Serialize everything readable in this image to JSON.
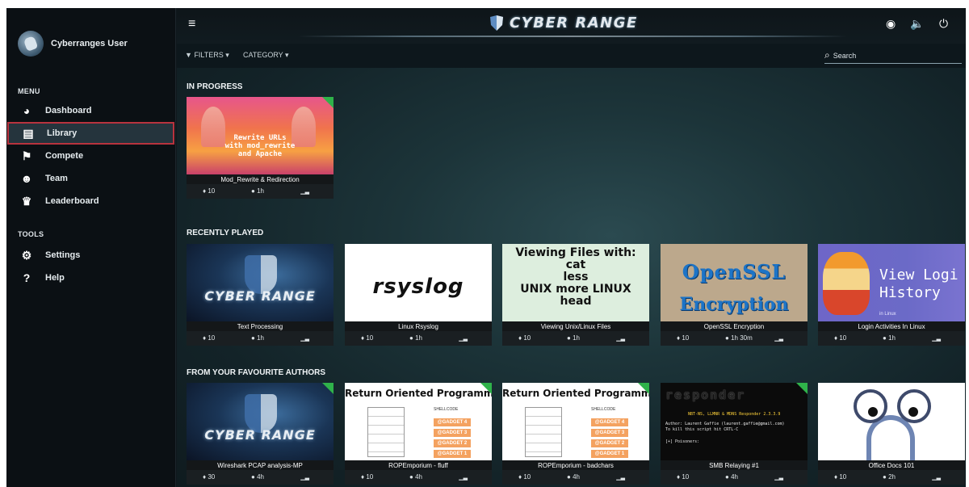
{
  "user": {
    "name": "Cyberranges User"
  },
  "sidebar": {
    "menu_label": "MENU",
    "tools_label": "TOOLS",
    "menu_items": [
      {
        "label": "Dashboard",
        "icon": "speedometer-icon"
      },
      {
        "label": "Library",
        "icon": "book-icon",
        "active": true
      },
      {
        "label": "Compete",
        "icon": "checkered-flag-icon"
      },
      {
        "label": "Team",
        "icon": "users-icon"
      },
      {
        "label": "Leaderboard",
        "icon": "trophy-icon"
      }
    ],
    "tool_items": [
      {
        "label": "Settings",
        "icon": "gear-icon"
      },
      {
        "label": "Help",
        "icon": "question-icon"
      }
    ]
  },
  "topbar": {
    "brand": "CYBER RANGE"
  },
  "filters": {
    "filters_label": "FILTERS",
    "category_label": "CATEGORY",
    "search_placeholder": "Search"
  },
  "sections": {
    "in_progress": "IN PROGRESS",
    "recently_played": "RECENTLY PLAYED",
    "favourite_authors": "FROM YOUR FAVOURITE AUTHORS"
  },
  "cards": {
    "mod": {
      "thumb_text": "Rewrite URLs\nwith mod_rewrite\nand Apache",
      "title": "Mod_Rewrite & Redirection",
      "points": "10",
      "time": "1h"
    },
    "text_processing": {
      "thumb_text": "CYBER RANGE",
      "title": "Text Processing",
      "points": "10",
      "time": "1h"
    },
    "rsyslog": {
      "thumb_text": "rsyslog",
      "title": "Linux Rsyslog",
      "points": "10",
      "time": "1h"
    },
    "viewing": {
      "thumb_text": "Viewing Files with:\ncat\nless\nUNIX more LINUX\nhead",
      "title": "Viewing Unix/Linux Files",
      "points": "10",
      "time": "1h"
    },
    "openssl": {
      "thumb_t1": "OpenSSL",
      "thumb_t2": "Encryption",
      "title": "OpenSSL Encryption",
      "points": "10",
      "time": "1h 30m"
    },
    "login": {
      "thumb_text": "View Logi\nHistory",
      "thumb_sub": "in Linux",
      "title": "Login Activities In Linux",
      "points": "10",
      "time": "1h"
    },
    "wireshark": {
      "thumb_text": "CYBER RANGE",
      "title": "Wireshark PCAP analysis-MP",
      "points": "30",
      "time": "4h"
    },
    "rop_fluff": {
      "thumb_head": "Return Oriented Programming",
      "title": "ROPEmporium - fluff",
      "points": "10",
      "time": "4h"
    },
    "rop_badchars": {
      "thumb_head": "Return Oriented Programming",
      "title": "ROPEmporium - badchars",
      "points": "10",
      "time": "4h"
    },
    "smb": {
      "thumb_logo": "responder",
      "thumb_line1": "NBT-NS, LLMNR & MDNS Responder 2.3.3.9",
      "thumb_line2": "Author: Laurent Gaffie (laurent.gaffie@gmail.com)",
      "thumb_line3": "To kill this script hit CRTL-C",
      "thumb_line4": "[+] Poisoners:",
      "title": "SMB Relaying #1",
      "points": "10",
      "time": "4h"
    },
    "office": {
      "title": "Office Docs 101",
      "points": "10",
      "time": "2h"
    }
  },
  "rop_gadgets": [
    "@GADGET 4",
    "@GADGET 3",
    "@GADGET 2",
    "@GADGET 1"
  ],
  "rop_label": "SHELLCODE"
}
